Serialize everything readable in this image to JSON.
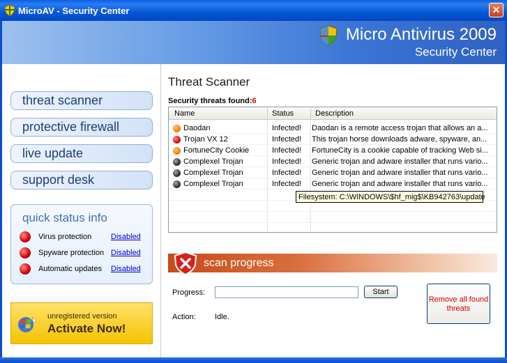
{
  "window": {
    "title": "MicroAV - Security Center",
    "close_glyph": "✕"
  },
  "banner": {
    "title": "Micro Antivirus 2009",
    "subtitle": "Security Center"
  },
  "nav": [
    {
      "label": "threat scanner"
    },
    {
      "label": "protective firewall"
    },
    {
      "label": "live update"
    },
    {
      "label": "support desk"
    }
  ],
  "quick_status": {
    "title": "quick status info",
    "items": [
      {
        "label": "Virus protection",
        "value": "Disabled"
      },
      {
        "label": "Spyware protection",
        "value": "Disabled"
      },
      {
        "label": "Automatic updates",
        "value": "Disabled"
      }
    ]
  },
  "activate": {
    "line1": "unregistered version",
    "line2": "Activate Now!"
  },
  "scanner": {
    "heading": "Threat Scanner",
    "found_label": "Security threats found:",
    "found_count": "6",
    "columns": [
      "Name",
      "Status",
      "Description"
    ],
    "rows": [
      {
        "icon": "orange",
        "name": "Daodan",
        "status": "Infected!",
        "desc": "Daodan is a remote access trojan that allows an a..."
      },
      {
        "icon": "red",
        "name": "Trojan VX 12",
        "status": "Infected!",
        "desc": "This trojan horse downloads adware, spyware, an..."
      },
      {
        "icon": "orange",
        "name": "FortuneCity Cookie",
        "status": "Infected!",
        "desc": "FortuneCity is a cookie capable of tracking Web si..."
      },
      {
        "icon": "black",
        "name": "Complexel Trojan",
        "status": "Infected!",
        "desc": "Generic trojan and adware installer that runs vario..."
      },
      {
        "icon": "black",
        "name": "Complexel Trojan",
        "status": "Infected!",
        "desc": "Generic trojan and adware installer that runs vario..."
      },
      {
        "icon": "black",
        "name": "Complexel Trojan",
        "status": "Infected!",
        "desc": "Generic trojan and adware installer that runs vario..."
      }
    ],
    "tooltip": "Filesystem: C:\\WINDOWS\\$hf_mig$\\KB942763\\update"
  },
  "progress": {
    "header": "scan progress",
    "progress_label": "Progress:",
    "start_label": "Start",
    "action_label": "Action:",
    "action_value": "Idle.",
    "remove_label": "Remove all found threats"
  },
  "colors": {
    "titlebar": "#0656d8",
    "accent_red": "#e00000",
    "link": "#0000cc"
  }
}
